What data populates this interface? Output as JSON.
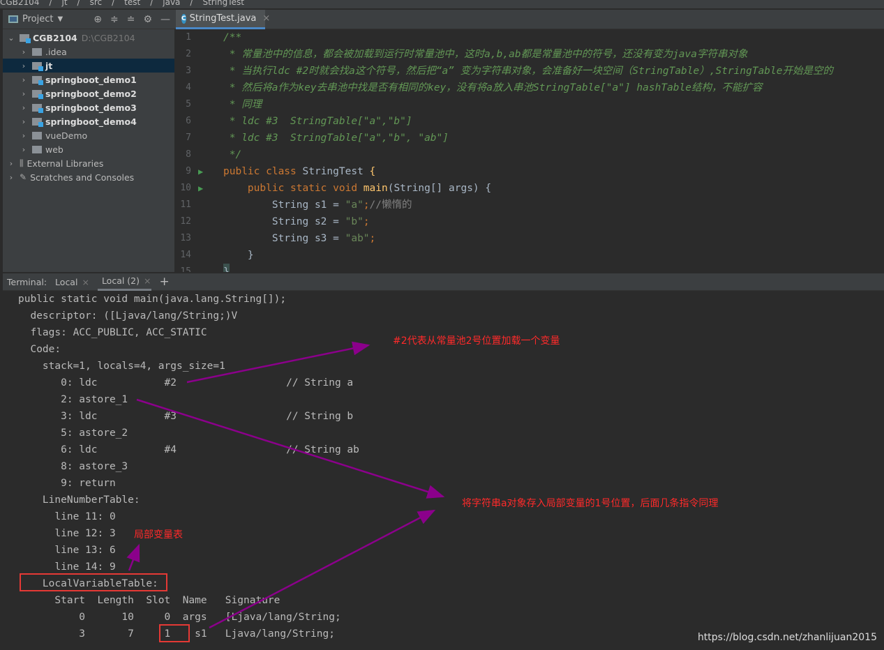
{
  "breadcrumb": [
    "CGB2104",
    "jt",
    "src",
    "test",
    "java",
    "StringTest"
  ],
  "sidebar": {
    "title": "Project",
    "items": [
      {
        "label": "CGB2104",
        "path": "D:\\CGB2104",
        "depth": 0,
        "expanded": true,
        "bold": true,
        "module": true
      },
      {
        "label": ".idea",
        "depth": 1
      },
      {
        "label": "jt",
        "depth": 1,
        "bold": true,
        "module": true,
        "selected": true
      },
      {
        "label": "springboot_demo1",
        "depth": 1,
        "bold": true,
        "module": true
      },
      {
        "label": "springboot_demo2",
        "depth": 1,
        "bold": true,
        "module": true
      },
      {
        "label": "springboot_demo3",
        "depth": 1,
        "bold": true,
        "module": true
      },
      {
        "label": "springboot_demo4",
        "depth": 1,
        "bold": true,
        "module": true
      },
      {
        "label": "vueDemo",
        "depth": 1
      },
      {
        "label": "web",
        "depth": 1
      },
      {
        "label": "External Libraries",
        "depth": 0,
        "icon": "library-icon"
      },
      {
        "label": "Scratches and Consoles",
        "depth": 0,
        "icon": "scratches-icon"
      }
    ]
  },
  "editor": {
    "tab": "StringTest.java",
    "lines": [
      [
        {
          "t": "/**",
          "c": "comment"
        }
      ],
      [
        {
          "t": " * 常量池中的信息，都会被加载到运行时常量池中，这时a,b,ab都是常量池中的符号，还没有变为java字符串对象",
          "c": "comment"
        }
      ],
      [
        {
          "t": " * 当执行ldc #2时就会找a这个符号，然后把“a” 变为字符串对象，会准备好一块空间（StringTable）,StringTable开始是空的",
          "c": "comment"
        }
      ],
      [
        {
          "t": " * 然后将a作为key去串池中找是否有相同的key，没有将a放入串池StringTable[\"a\"] hashTable结构，不能扩容",
          "c": "comment"
        }
      ],
      [
        {
          "t": " * 同理",
          "c": "comment"
        }
      ],
      [
        {
          "t": " * ldc #3  StringTable[\"a\",\"b\"]",
          "c": "comment"
        }
      ],
      [
        {
          "t": " * ldc #3  StringTable[\"a\",\"b\", \"ab\"]",
          "c": "comment"
        }
      ],
      [
        {
          "t": " */",
          "c": "comment"
        }
      ],
      [
        {
          "t": "public class ",
          "c": "keyword"
        },
        {
          "t": "StringTest ",
          "c": "plain"
        },
        {
          "t": "{",
          "c": "method"
        }
      ],
      [
        {
          "t": "    public static void ",
          "c": "keyword"
        },
        {
          "t": "main",
          "c": "method"
        },
        {
          "t": "(String[] args) {",
          "c": "plain"
        }
      ],
      [
        {
          "t": "        String s1 = ",
          "c": "plain"
        },
        {
          "t": "\"a\"",
          "c": "string"
        },
        {
          "t": ";",
          "c": "keyword"
        },
        {
          "t": "//懒惰的",
          "c": "line-comment"
        }
      ],
      [
        {
          "t": "        String s2 = ",
          "c": "plain"
        },
        {
          "t": "\"b\"",
          "c": "string"
        },
        {
          "t": ";",
          "c": "keyword"
        }
      ],
      [
        {
          "t": "        String s3 = ",
          "c": "plain"
        },
        {
          "t": "\"ab\"",
          "c": "string"
        },
        {
          "t": ";",
          "c": "keyword"
        }
      ],
      [
        {
          "t": "    }",
          "c": "plain"
        }
      ],
      [
        {
          "t": "}",
          "c": "brace-hl"
        }
      ]
    ],
    "run_lines": [
      9,
      10
    ]
  },
  "terminal": {
    "label": "Terminal:",
    "tabs": [
      "Local",
      "Local (2)"
    ],
    "active_tab": 1,
    "lines": [
      "public static void main(java.lang.String[]);",
      "  descriptor: ([Ljava/lang/String;)V",
      "  flags: ACC_PUBLIC, ACC_STATIC",
      "  Code:",
      "    stack=1, locals=4, args_size=1",
      "       0: ldc           #2                  // String a",
      "       2: astore_1",
      "       3: ldc           #3                  // String b",
      "       5: astore_2",
      "       6: ldc           #4                  // String ab",
      "       8: astore_3",
      "       9: return",
      "    LineNumberTable:",
      "      line 11: 0",
      "      line 12: 3",
      "      line 13: 6",
      "      line 14: 9",
      "    LocalVariableTable:",
      "      Start  Length  Slot  Name   Signature",
      "          0      10     0  args   [Ljava/lang/String;",
      "          3       7     1    s1   Ljava/lang/String;"
    ]
  },
  "annotations": {
    "ldc_note": "#2代表从常量池2号位置加载一个变量",
    "astore_note": "将字符串a对象存入局部变量的1号位置，后面几条指令同理",
    "lvt_note": "局部变量表",
    "arrow_color": "#8b008b",
    "highlight_color": "#e53935"
  },
  "watermark": "https://blog.csdn.net/zhanlijuan2015"
}
